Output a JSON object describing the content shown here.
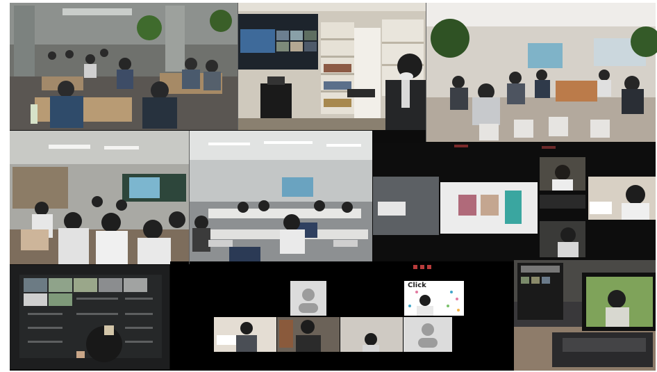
{
  "photos": [
    {
      "scene": "workshop-room-overhead",
      "colors": {
        "floor": "#5e5a55",
        "wall": "#7f8683"
      }
    },
    {
      "scene": "presenter-with-video-screen",
      "colors": {
        "screen": "#222a33",
        "shelf": "#d8d3c7"
      }
    },
    {
      "scene": "open-office-seminar",
      "colors": {
        "floor": "#b9b0a5",
        "wall": "#d9d4cc"
      }
    },
    {
      "scene": "school-classroom",
      "colors": {
        "wall": "#a8a8a2",
        "desk": "#8a7a66"
      }
    },
    {
      "scene": "computer-lab-lecture",
      "colors": {
        "wall": "#c9cbca",
        "floor": "#8b8e90"
      }
    },
    {
      "scene": "video-call-screens",
      "colors": {
        "bg": "#101010"
      }
    },
    {
      "scene": "laptop-grid-call",
      "colors": {
        "bg": "#2a2b2c"
      }
    },
    {
      "scene": "online-meeting-gallery",
      "colors": {
        "bg": "#000000"
      }
    },
    {
      "scene": "laptop-on-desk-call",
      "colors": {
        "bg": "#3a3936"
      }
    }
  ],
  "overlays": {
    "card_title": "Click"
  }
}
